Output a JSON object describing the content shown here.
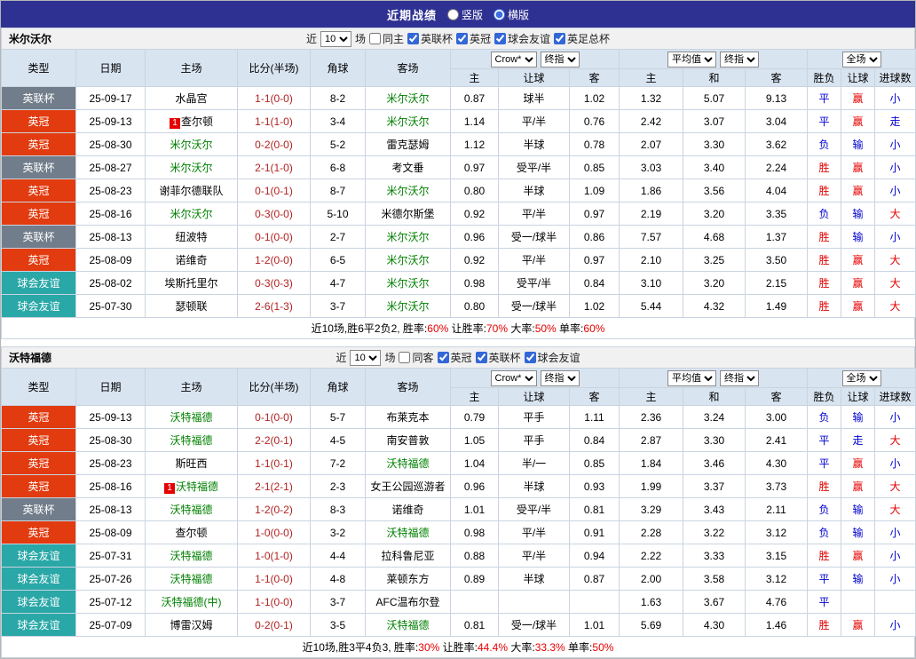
{
  "topbar": {
    "title": "近期战绩",
    "options": [
      {
        "label": "竖版",
        "checked": false
      },
      {
        "label": "横版",
        "checked": true
      }
    ]
  },
  "headers": {
    "cols": [
      "类型",
      "日期",
      "主场",
      "比分(半场)",
      "角球",
      "客场"
    ],
    "sub": [
      "主",
      "让球",
      "客",
      "主",
      "和",
      "客",
      "胜负",
      "让球",
      "进球数"
    ]
  },
  "selects": {
    "company": "Crow*",
    "final": "终指",
    "average": "平均值",
    "full": "全场"
  },
  "palette": {
    "topbar_bg": "#2e3192",
    "header_bg": "#d9e4f1",
    "focus_green": "#008000",
    "score_red": "#b22222",
    "result_red": "#e60000",
    "result_blue": "#0000d0"
  },
  "league_colors": {
    "英联杯": "#717d8a",
    "英冠": "#e23b0f",
    "球会友谊": "#2aa7a7"
  },
  "sections": [
    {
      "team": "米尔沃尔",
      "filters": {
        "near": "近",
        "count": "10",
        "games": "场",
        "same": {
          "label": "同主",
          "checked": false
        },
        "comps": [
          {
            "label": "英联杯",
            "checked": true
          },
          {
            "label": "英冠",
            "checked": true
          },
          {
            "label": "球会友谊",
            "checked": true
          },
          {
            "label": "英足总杯",
            "checked": true
          }
        ]
      },
      "rows": [
        {
          "lg": "英联杯",
          "date": "25-09-17",
          "home": "水晶宫",
          "hf": false,
          "hr": "",
          "score": "1-1(0-0)",
          "cor": "8-2",
          "away": "米尔沃尔",
          "af": true,
          "ar": "",
          "o1": "0.87",
          "ln": "球半",
          "o2": "1.02",
          "e1": "1.32",
          "e2": "5.07",
          "e3": "9.13",
          "rv": [
            "平",
            "赢",
            "小"
          ],
          "rc": [
            "b",
            "r",
            "b"
          ]
        },
        {
          "lg": "英冠",
          "date": "25-09-13",
          "home": "查尔顿",
          "hf": false,
          "hr": "1",
          "score": "1-1(1-0)",
          "cor": "3-4",
          "away": "米尔沃尔",
          "af": true,
          "ar": "",
          "o1": "1.14",
          "ln": "平/半",
          "o2": "0.76",
          "e1": "2.42",
          "e2": "3.07",
          "e3": "3.04",
          "rv": [
            "平",
            "赢",
            "走"
          ],
          "rc": [
            "b",
            "r",
            "b"
          ]
        },
        {
          "lg": "英冠",
          "date": "25-08-30",
          "home": "米尔沃尔",
          "hf": true,
          "hr": "",
          "score": "0-2(0-0)",
          "cor": "5-2",
          "away": "雷克瑟姆",
          "af": false,
          "ar": "",
          "o1": "1.12",
          "ln": "半球",
          "o2": "0.78",
          "e1": "2.07",
          "e2": "3.30",
          "e3": "3.62",
          "rv": [
            "负",
            "输",
            "小"
          ],
          "rc": [
            "b",
            "b",
            "b"
          ]
        },
        {
          "lg": "英联杯",
          "date": "25-08-27",
          "home": "米尔沃尔",
          "hf": true,
          "hr": "",
          "score": "2-1(1-0)",
          "cor": "6-8",
          "away": "考文垂",
          "af": false,
          "ar": "",
          "o1": "0.97",
          "ln": "受平/半",
          "o2": "0.85",
          "e1": "3.03",
          "e2": "3.40",
          "e3": "2.24",
          "rv": [
            "胜",
            "赢",
            "小"
          ],
          "rc": [
            "r",
            "r",
            "b"
          ]
        },
        {
          "lg": "英冠",
          "date": "25-08-23",
          "home": "谢菲尔德联队",
          "hf": false,
          "hr": "",
          "score": "0-1(0-1)",
          "cor": "8-7",
          "away": "米尔沃尔",
          "af": true,
          "ar": "",
          "o1": "0.80",
          "ln": "半球",
          "o2": "1.09",
          "e1": "1.86",
          "e2": "3.56",
          "e3": "4.04",
          "rv": [
            "胜",
            "赢",
            "小"
          ],
          "rc": [
            "r",
            "r",
            "b"
          ]
        },
        {
          "lg": "英冠",
          "date": "25-08-16",
          "home": "米尔沃尔",
          "hf": true,
          "hr": "",
          "score": "0-3(0-0)",
          "cor": "5-10",
          "away": "米德尔斯堡",
          "af": false,
          "ar": "",
          "o1": "0.92",
          "ln": "平/半",
          "o2": "0.97",
          "e1": "2.19",
          "e2": "3.20",
          "e3": "3.35",
          "rv": [
            "负",
            "输",
            "大"
          ],
          "rc": [
            "b",
            "b",
            "r"
          ]
        },
        {
          "lg": "英联杯",
          "date": "25-08-13",
          "home": "纽波特",
          "hf": false,
          "hr": "",
          "score": "0-1(0-0)",
          "cor": "2-7",
          "away": "米尔沃尔",
          "af": true,
          "ar": "",
          "o1": "0.96",
          "ln": "受一/球半",
          "o2": "0.86",
          "e1": "7.57",
          "e2": "4.68",
          "e3": "1.37",
          "rv": [
            "胜",
            "输",
            "小"
          ],
          "rc": [
            "r",
            "b",
            "b"
          ]
        },
        {
          "lg": "英冠",
          "date": "25-08-09",
          "home": "诺维奇",
          "hf": false,
          "hr": "",
          "score": "1-2(0-0)",
          "cor": "6-5",
          "away": "米尔沃尔",
          "af": true,
          "ar": "",
          "o1": "0.92",
          "ln": "平/半",
          "o2": "0.97",
          "e1": "2.10",
          "e2": "3.25",
          "e3": "3.50",
          "rv": [
            "胜",
            "赢",
            "大"
          ],
          "rc": [
            "r",
            "r",
            "r"
          ]
        },
        {
          "lg": "球会友谊",
          "date": "25-08-02",
          "home": "埃斯托里尔",
          "hf": false,
          "hr": "",
          "score": "0-3(0-3)",
          "cor": "4-7",
          "away": "米尔沃尔",
          "af": true,
          "ar": "",
          "o1": "0.98",
          "ln": "受平/半",
          "o2": "0.84",
          "e1": "3.10",
          "e2": "3.20",
          "e3": "2.15",
          "rv": [
            "胜",
            "赢",
            "大"
          ],
          "rc": [
            "r",
            "r",
            "r"
          ]
        },
        {
          "lg": "球会友谊",
          "date": "25-07-30",
          "home": "瑟顿联",
          "hf": false,
          "hr": "",
          "score": "2-6(1-3)",
          "cor": "3-7",
          "away": "米尔沃尔",
          "af": true,
          "ar": "",
          "o1": "0.80",
          "ln": "受一/球半",
          "o2": "1.02",
          "e1": "5.44",
          "e2": "4.32",
          "e3": "1.49",
          "rv": [
            "胜",
            "赢",
            "大"
          ],
          "rc": [
            "r",
            "r",
            "r"
          ]
        }
      ],
      "summary": [
        {
          "t": "近10场,胜6平2负2, 胜率:",
          "c": ""
        },
        {
          "t": "60%",
          "c": "red"
        },
        {
          "t": " 让胜率:",
          "c": ""
        },
        {
          "t": "70%",
          "c": "red"
        },
        {
          "t": " 大率:",
          "c": ""
        },
        {
          "t": "50%",
          "c": "red"
        },
        {
          "t": " 单率:",
          "c": ""
        },
        {
          "t": "60%",
          "c": "red"
        }
      ]
    },
    {
      "team": "沃特福德",
      "filters": {
        "near": "近",
        "count": "10",
        "games": "场",
        "same": {
          "label": "同客",
          "checked": false
        },
        "comps": [
          {
            "label": "英冠",
            "checked": true
          },
          {
            "label": "英联杯",
            "checked": true
          },
          {
            "label": "球会友谊",
            "checked": true
          }
        ]
      },
      "rows": [
        {
          "lg": "英冠",
          "date": "25-09-13",
          "home": "沃特福德",
          "hf": true,
          "hr": "",
          "score": "0-1(0-0)",
          "cor": "5-7",
          "away": "布莱克本",
          "af": false,
          "ar": "",
          "o1": "0.79",
          "ln": "平手",
          "o2": "1.11",
          "e1": "2.36",
          "e2": "3.24",
          "e3": "3.00",
          "rv": [
            "负",
            "输",
            "小"
          ],
          "rc": [
            "b",
            "b",
            "b"
          ]
        },
        {
          "lg": "英冠",
          "date": "25-08-30",
          "home": "沃特福德",
          "hf": true,
          "hr": "",
          "score": "2-2(0-1)",
          "cor": "4-5",
          "away": "南安普敦",
          "af": false,
          "ar": "",
          "o1": "1.05",
          "ln": "平手",
          "o2": "0.84",
          "e1": "2.87",
          "e2": "3.30",
          "e3": "2.41",
          "rv": [
            "平",
            "走",
            "大"
          ],
          "rc": [
            "b",
            "b",
            "r"
          ]
        },
        {
          "lg": "英冠",
          "date": "25-08-23",
          "home": "斯旺西",
          "hf": false,
          "hr": "",
          "score": "1-1(0-1)",
          "cor": "7-2",
          "away": "沃特福德",
          "af": true,
          "ar": "",
          "o1": "1.04",
          "ln": "半/一",
          "o2": "0.85",
          "e1": "1.84",
          "e2": "3.46",
          "e3": "4.30",
          "rv": [
            "平",
            "赢",
            "小"
          ],
          "rc": [
            "b",
            "r",
            "b"
          ]
        },
        {
          "lg": "英冠",
          "date": "25-08-16",
          "home": "沃特福德",
          "hf": true,
          "hr": "1",
          "score": "2-1(2-1)",
          "cor": "2-3",
          "away": "女王公园巡游者",
          "af": false,
          "ar": "",
          "o1": "0.96",
          "ln": "半球",
          "o2": "0.93",
          "e1": "1.99",
          "e2": "3.37",
          "e3": "3.73",
          "rv": [
            "胜",
            "赢",
            "大"
          ],
          "rc": [
            "r",
            "r",
            "r"
          ]
        },
        {
          "lg": "英联杯",
          "date": "25-08-13",
          "home": "沃特福德",
          "hf": true,
          "hr": "",
          "score": "1-2(0-2)",
          "cor": "8-3",
          "away": "诺维奇",
          "af": false,
          "ar": "",
          "o1": "1.01",
          "ln": "受平/半",
          "o2": "0.81",
          "e1": "3.29",
          "e2": "3.43",
          "e3": "2.11",
          "rv": [
            "负",
            "输",
            "大"
          ],
          "rc": [
            "b",
            "b",
            "r"
          ]
        },
        {
          "lg": "英冠",
          "date": "25-08-09",
          "home": "查尔顿",
          "hf": false,
          "hr": "",
          "score": "1-0(0-0)",
          "cor": "3-2",
          "away": "沃特福德",
          "af": true,
          "ar": "",
          "o1": "0.98",
          "ln": "平/半",
          "o2": "0.91",
          "e1": "2.28",
          "e2": "3.22",
          "e3": "3.12",
          "rv": [
            "负",
            "输",
            "小"
          ],
          "rc": [
            "b",
            "b",
            "b"
          ]
        },
        {
          "lg": "球会友谊",
          "date": "25-07-31",
          "home": "沃特福德",
          "hf": true,
          "hr": "",
          "score": "1-0(1-0)",
          "cor": "4-4",
          "away": "拉科鲁尼亚",
          "af": false,
          "ar": "",
          "o1": "0.88",
          "ln": "平/半",
          "o2": "0.94",
          "e1": "2.22",
          "e2": "3.33",
          "e3": "3.15",
          "rv": [
            "胜",
            "赢",
            "小"
          ],
          "rc": [
            "r",
            "r",
            "b"
          ]
        },
        {
          "lg": "球会友谊",
          "date": "25-07-26",
          "home": "沃特福德",
          "hf": true,
          "hr": "",
          "score": "1-1(0-0)",
          "cor": "4-8",
          "away": "莱顿东方",
          "af": false,
          "ar": "",
          "o1": "0.89",
          "ln": "半球",
          "o2": "0.87",
          "e1": "2.00",
          "e2": "3.58",
          "e3": "3.12",
          "rv": [
            "平",
            "输",
            "小"
          ],
          "rc": [
            "b",
            "b",
            "b"
          ]
        },
        {
          "lg": "球会友谊",
          "date": "25-07-12",
          "home": "沃特福德(中)",
          "hf": true,
          "hr": "",
          "score": "1-1(0-0)",
          "cor": "3-7",
          "away": "AFC温布尔登",
          "af": false,
          "ar": "",
          "o1": "",
          "ln": "",
          "o2": "",
          "e1": "1.63",
          "e2": "3.67",
          "e3": "4.76",
          "rv": [
            "平",
            "",
            ""
          ],
          "rc": [
            "b",
            "",
            ""
          ]
        },
        {
          "lg": "球会友谊",
          "date": "25-07-09",
          "home": "博雷汉姆",
          "hf": false,
          "hr": "",
          "score": "0-2(0-1)",
          "cor": "3-5",
          "away": "沃特福德",
          "af": true,
          "ar": "",
          "o1": "0.81",
          "ln": "受一/球半",
          "o2": "1.01",
          "e1": "5.69",
          "e2": "4.30",
          "e3": "1.46",
          "rv": [
            "胜",
            "赢",
            "小"
          ],
          "rc": [
            "r",
            "r",
            "b"
          ]
        }
      ],
      "summary": [
        {
          "t": "近10场,胜3平4负3, 胜率:",
          "c": ""
        },
        {
          "t": "30%",
          "c": "red"
        },
        {
          "t": " 让胜率:",
          "c": ""
        },
        {
          "t": "44.4%",
          "c": "red"
        },
        {
          "t": " 大率:",
          "c": ""
        },
        {
          "t": "33.3%",
          "c": "red"
        },
        {
          "t": " 单率:",
          "c": ""
        },
        {
          "t": "50%",
          "c": "red"
        }
      ]
    }
  ]
}
